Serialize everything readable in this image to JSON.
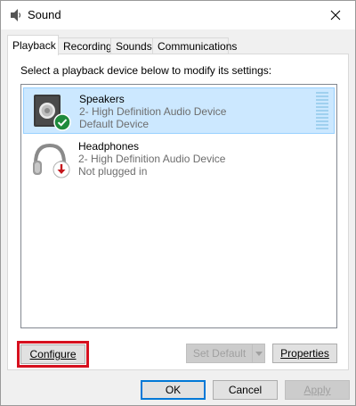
{
  "window": {
    "title": "Sound"
  },
  "tabs": [
    {
      "label": "Playback",
      "active": true
    },
    {
      "label": "Recording",
      "active": false
    },
    {
      "label": "Sounds",
      "active": false
    },
    {
      "label": "Communications",
      "active": false
    }
  ],
  "panel": {
    "instruction": "Select a playback device below to modify its settings:"
  },
  "devices": [
    {
      "name": "Speakers",
      "description": "2- High Definition Audio Device",
      "status": "Default Device",
      "icon": "speaker-icon",
      "badge": "check-badge-icon",
      "selected": true
    },
    {
      "name": "Headphones",
      "description": "2- High Definition Audio Device",
      "status": "Not plugged in",
      "icon": "headphones-icon",
      "badge": "unplugged-badge-icon",
      "selected": false
    }
  ],
  "buttons": {
    "configure": "Configure",
    "set_default": "Set Default",
    "properties": "Properties",
    "ok": "OK",
    "cancel": "Cancel",
    "apply": "Apply"
  },
  "colors": {
    "selection": "#cce8ff",
    "highlight_box": "#d6101e",
    "accent": "#0078d7"
  }
}
